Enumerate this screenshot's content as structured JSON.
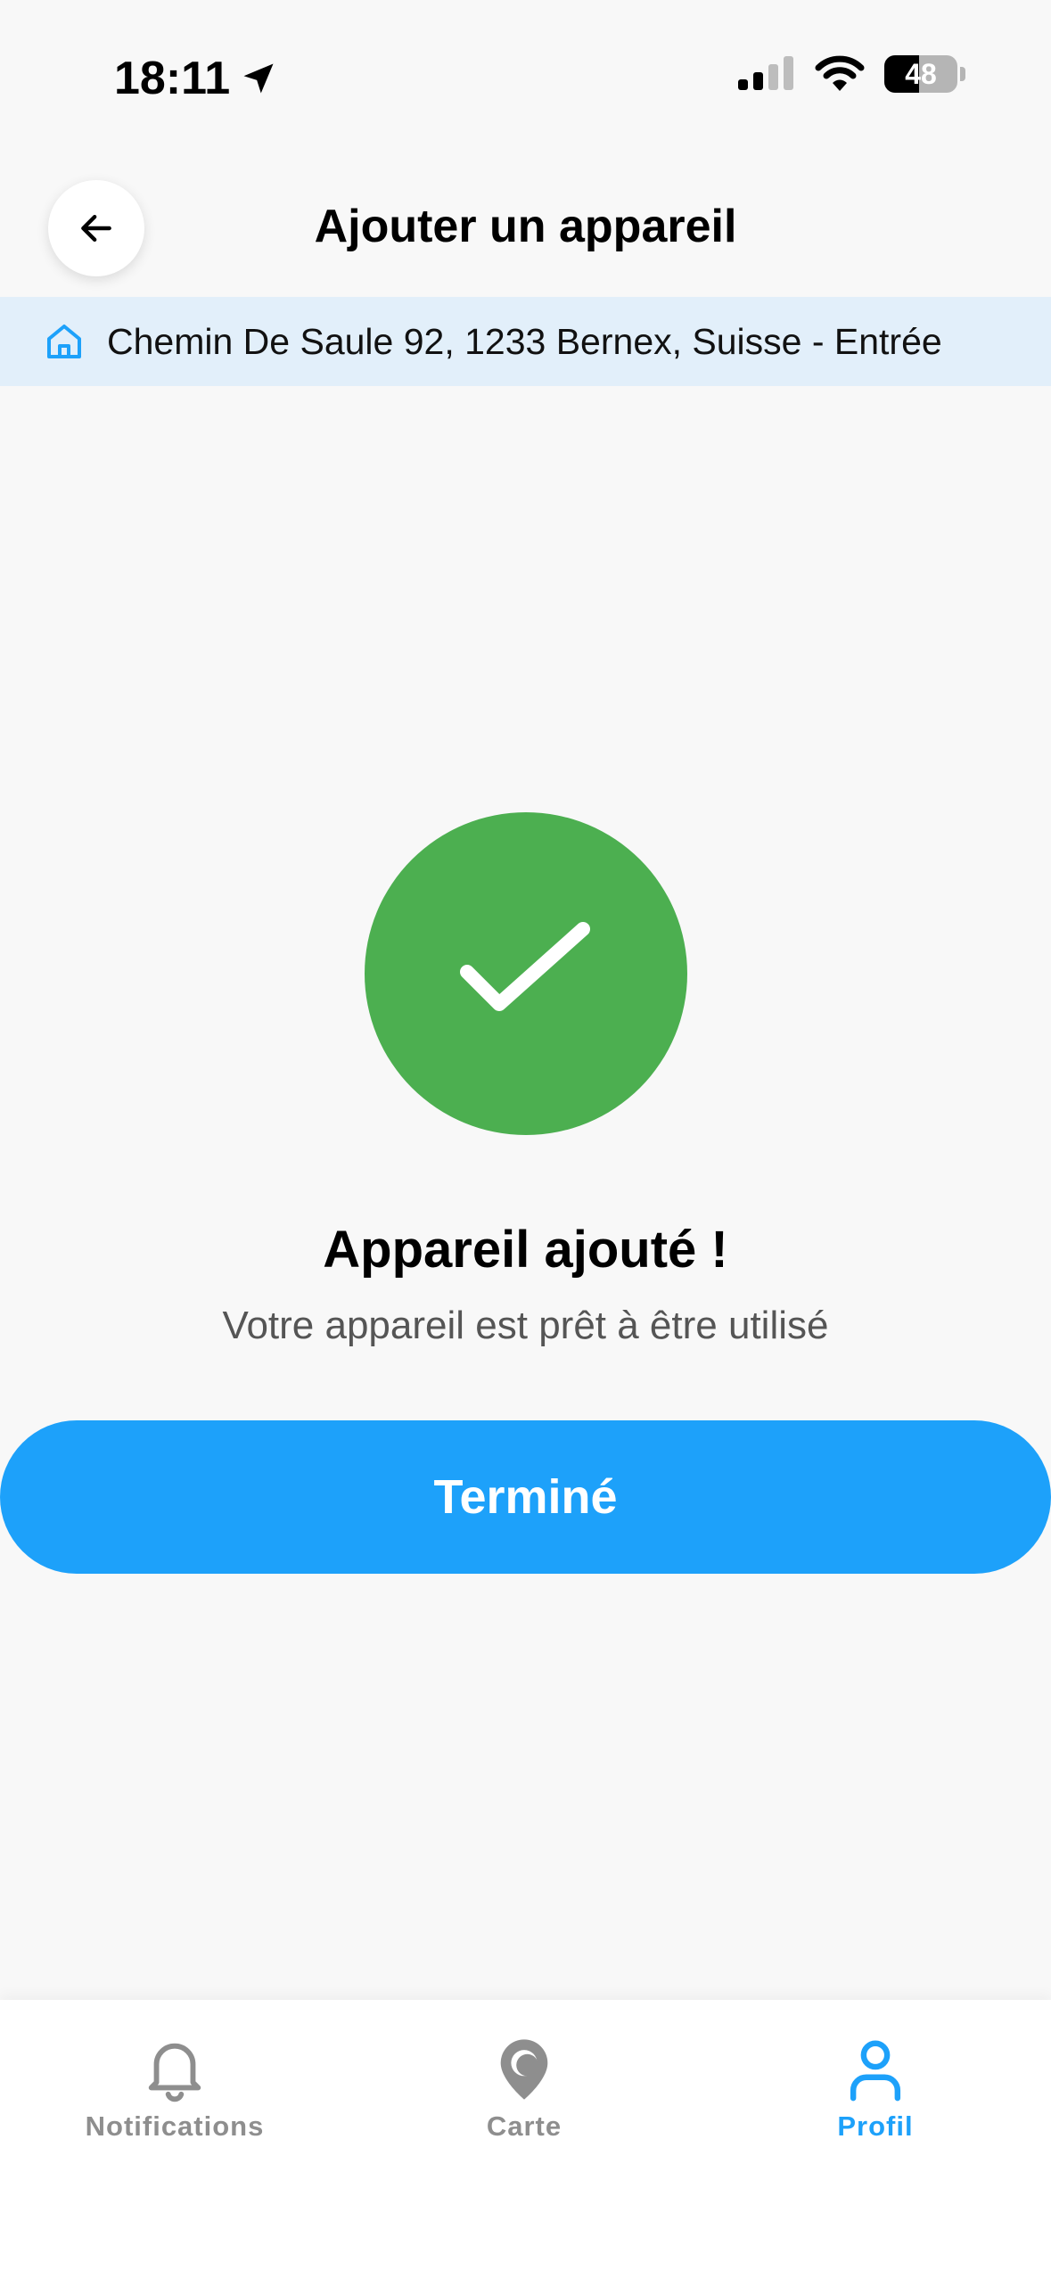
{
  "status_bar": {
    "time": "18:11",
    "battery_level": "48",
    "battery_fraction": 0.48,
    "location_icon": "location-arrow-icon",
    "signal_icon": "cellular-signal-icon",
    "wifi_icon": "wifi-icon"
  },
  "header": {
    "title": "Ajouter un appareil",
    "back_icon": "arrow-left-icon"
  },
  "address": {
    "icon": "home-icon",
    "text": "Chemin De Saule 92, 1233 Bernex, Suisse - Entrée"
  },
  "success": {
    "icon": "checkmark-icon",
    "title": "Appareil ajouté !",
    "subtitle": "Votre appareil est prêt à être utilisé",
    "button_label": "Terminé"
  },
  "tab_bar": {
    "tabs": [
      {
        "label": "Notifications",
        "icon": "bell-icon",
        "active": false
      },
      {
        "label": "Carte",
        "icon": "map-pin-icon",
        "active": false
      },
      {
        "label": "Profil",
        "icon": "user-icon",
        "active": true
      }
    ]
  },
  "colors": {
    "background": "#f8f8f8",
    "accent": "#1da1fa",
    "success": "#4caf50",
    "address_banner": "#e2effa",
    "inactive_tab": "#8e8e8e"
  }
}
